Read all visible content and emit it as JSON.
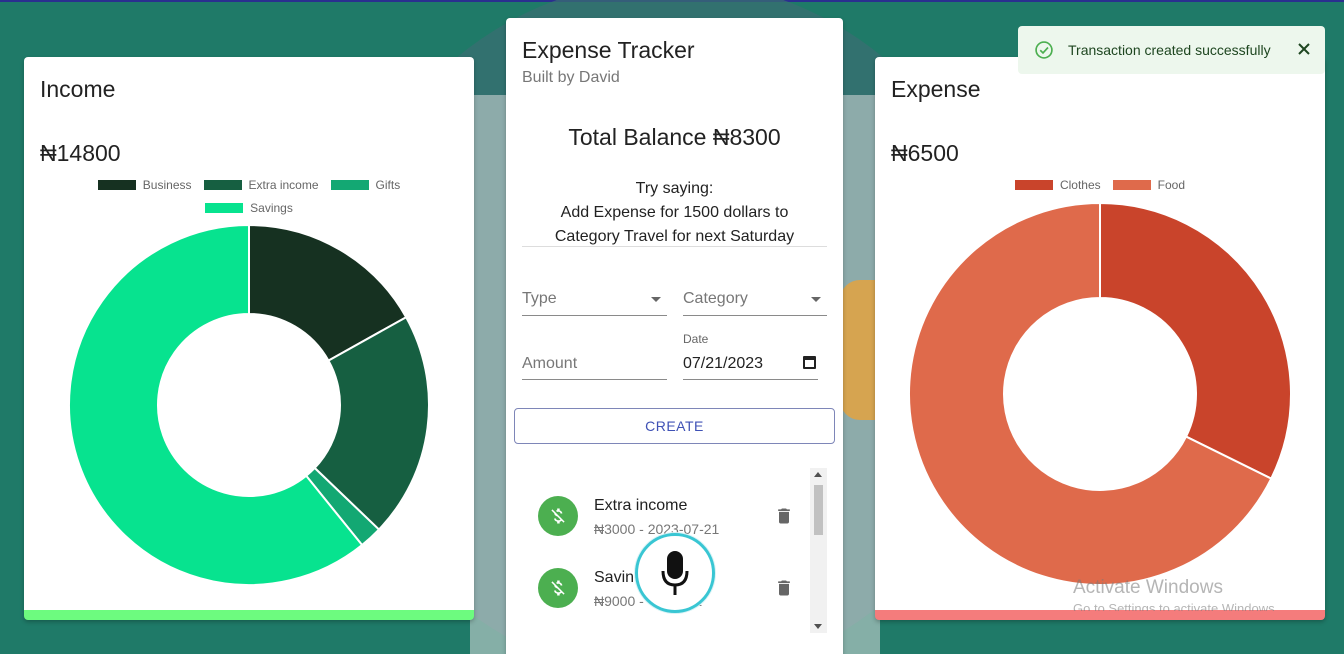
{
  "income": {
    "title": "Income",
    "amount": "₦14800",
    "legend": [
      {
        "label": "Business",
        "color": "#163121"
      },
      {
        "label": "Extra income",
        "color": "#165f41"
      },
      {
        "label": "Gifts",
        "color": "#13a873"
      },
      {
        "label": "Savings",
        "color": "#07e38f"
      }
    ],
    "bar_color": "#6dfb7f"
  },
  "expense": {
    "title": "Expense",
    "amount": "₦6500",
    "legend": [
      {
        "label": "Clothes",
        "color": "#c9442b"
      },
      {
        "label": "Food",
        "color": "#df6a4b"
      }
    ],
    "bar_color": "#f47c7c"
  },
  "chart_data": [
    {
      "type": "pie",
      "variant": "doughnut",
      "title": "Income",
      "categories": [
        "Business",
        "Extra income",
        "Gifts",
        "Savings"
      ],
      "values": [
        2500,
        3000,
        300,
        9000
      ],
      "colors": [
        "#163121",
        "#165f41",
        "#13a873",
        "#07e38f"
      ],
      "legend_position": "top"
    },
    {
      "type": "pie",
      "variant": "doughnut",
      "title": "Expense",
      "categories": [
        "Clothes",
        "Food"
      ],
      "values": [
        2100,
        4400
      ],
      "colors": [
        "#c9442b",
        "#df6a4b"
      ],
      "legend_position": "top"
    }
  ],
  "main": {
    "title": "Expense Tracker",
    "subtitle": "Built by David",
    "balance": "Total Balance ₦8300",
    "hint_line1": "Try saying:",
    "hint_line2": "Add Expense for 1500 dollars to",
    "hint_line3": "Category Travel for next Saturday",
    "form": {
      "type_label": "Type",
      "category_label": "Category",
      "amount_label": "Amount",
      "date_label": "Date",
      "date_value": "07/21/2023"
    },
    "create_label": "CREATE",
    "transactions": [
      {
        "title": "Extra income",
        "subtitle": "₦3000 - 2023-07-21"
      },
      {
        "title": "Savin",
        "subtitle": "₦9000 -           21"
      }
    ]
  },
  "toast": {
    "message": "Transaction created successfully"
  },
  "watermark": {
    "title": "Activate Windows",
    "subtitle": "Go to Settings to activate Windows."
  }
}
